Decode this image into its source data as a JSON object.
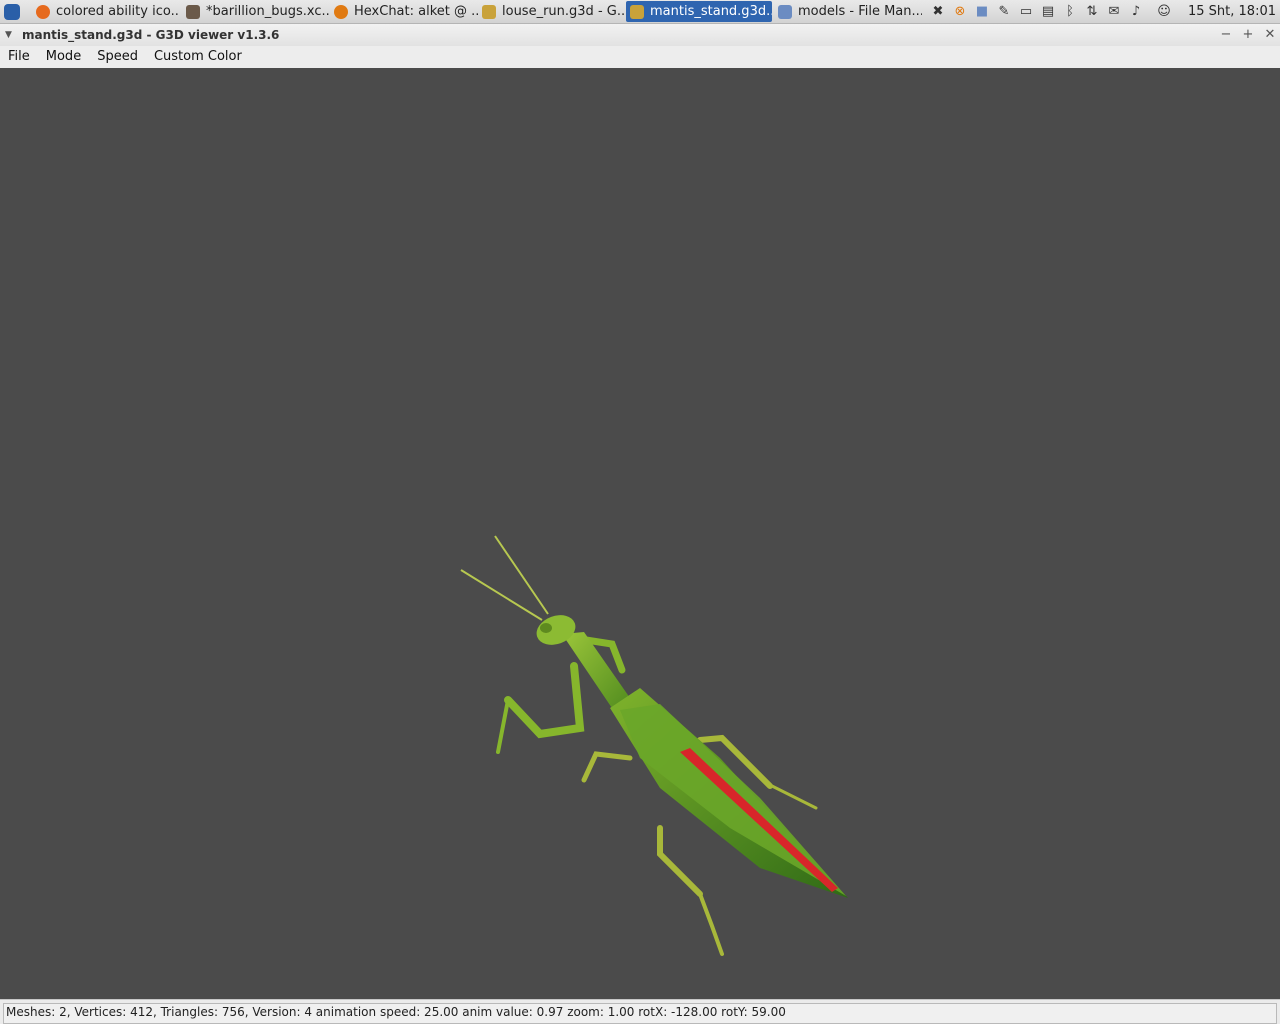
{
  "panel": {
    "tasks": [
      {
        "label": "colored ability ico...",
        "icon": "firefox-icon",
        "color": "#e66a1e",
        "active": false
      },
      {
        "label": "*barillion_bugs.xc...",
        "icon": "gimp-icon",
        "color": "#6b5a4a",
        "active": false
      },
      {
        "label": "HexChat: alket @ ...",
        "icon": "hexchat-icon",
        "color": "#e07a12",
        "active": false
      },
      {
        "label": "louse_run.g3d - G...",
        "icon": "g3d-viewer-icon",
        "color": "#c9a23a",
        "active": false
      },
      {
        "label": "mantis_stand.g3d...",
        "icon": "g3d-viewer-icon",
        "color": "#c9a23a",
        "active": true
      },
      {
        "label": "models - File Man...",
        "icon": "folder-icon",
        "color": "#6b8cc2",
        "active": false
      }
    ],
    "clock": "15 Sht, 18:01"
  },
  "window": {
    "title": "mantis_stand.g3d - G3D viewer v1.3.6"
  },
  "menu": [
    "File",
    "Mode",
    "Speed",
    "Custom Color"
  ],
  "status": {
    "text": "Meshes: 2, Vertices: 412, Triangles: 756, Version: 4 animation speed: 25.00 anim value: 0.97 zoom: 1.00 rotX: -128.00 rotY: 59.00"
  },
  "colors": {
    "viewport_bg": "#4b4b4b",
    "active_task": "#2f65b0",
    "mantis_green": "#6aa629",
    "mantis_stripe": "#d8262a"
  }
}
